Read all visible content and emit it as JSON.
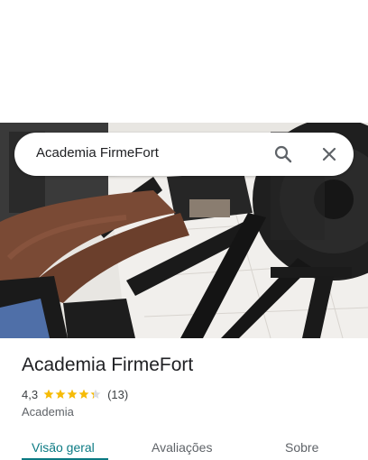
{
  "search": {
    "query": "Academia FirmeFort"
  },
  "place": {
    "title": "Academia FirmeFort",
    "rating_text": "4,3",
    "rating_value": 4.3,
    "rating_max": 5,
    "reviews_count": "(13)",
    "category": "Academia"
  },
  "tabs": [
    {
      "label": "Visão geral",
      "active": true
    },
    {
      "label": "Avaliações",
      "active": false
    },
    {
      "label": "Sobre",
      "active": false
    }
  ],
  "colors": {
    "accent": "#0b7a83",
    "star": "#f6bb06"
  }
}
